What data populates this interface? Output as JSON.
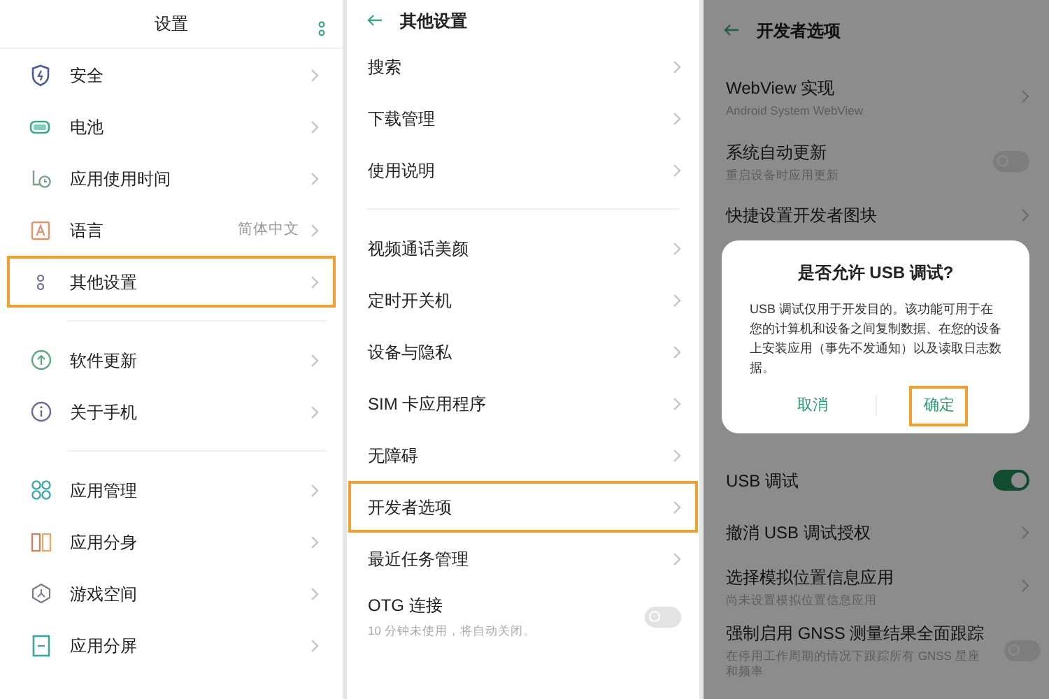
{
  "settings": {
    "title": "设置",
    "groups": [
      {
        "items": [
          {
            "label": "安全",
            "highlighted": false
          },
          {
            "label": "电池",
            "highlighted": false
          },
          {
            "label": "应用使用时间",
            "highlighted": false
          },
          {
            "label": "语言",
            "value": "简体中文",
            "highlighted": false
          },
          {
            "label": "其他设置",
            "highlighted": true
          }
        ]
      },
      {
        "items": [
          {
            "label": "软件更新",
            "highlighted": false
          },
          {
            "label": "关于手机",
            "highlighted": false
          }
        ]
      },
      {
        "items": [
          {
            "label": "应用管理",
            "highlighted": false
          },
          {
            "label": "应用分身",
            "highlighted": false
          },
          {
            "label": "游戏空间",
            "highlighted": false
          },
          {
            "label": "应用分屏",
            "highlighted": false
          }
        ]
      }
    ]
  },
  "other_settings": {
    "title": "其他设置",
    "groups": [
      {
        "items": [
          {
            "kind": "link",
            "label": "搜索",
            "highlighted": false
          },
          {
            "kind": "link",
            "label": "下载管理",
            "highlighted": false
          },
          {
            "kind": "link",
            "label": "使用说明",
            "highlighted": false
          }
        ]
      },
      {
        "items": [
          {
            "kind": "link",
            "label": "视频通话美颜",
            "highlighted": false
          },
          {
            "kind": "link",
            "label": "定时开关机",
            "highlighted": false
          },
          {
            "kind": "link",
            "label": "设备与隐私",
            "highlighted": false
          },
          {
            "kind": "link",
            "label": "SIM 卡应用程序",
            "highlighted": false
          },
          {
            "kind": "link",
            "label": "无障碍",
            "highlighted": false
          },
          {
            "kind": "link",
            "label": "开发者选项",
            "highlighted": true
          },
          {
            "kind": "link",
            "label": "最近任务管理",
            "highlighted": false
          },
          {
            "kind": "toggle",
            "label": "OTG 连接",
            "subtitle": "10 分钟未使用，将自动关闭。",
            "on": false,
            "highlighted": false
          }
        ]
      }
    ]
  },
  "developer_options": {
    "title": "开发者选项",
    "items_above": [
      {
        "kind": "link",
        "label": "WebView 实现",
        "subtitle": "Android System WebView"
      },
      {
        "kind": "toggle",
        "label": "系统自动更新",
        "subtitle": "重启设备时应用更新",
        "on": false
      },
      {
        "kind": "link",
        "label": "快捷设置开发者图块"
      }
    ],
    "items_below": [
      {
        "kind": "toggle",
        "label": "USB 调试",
        "on": true
      },
      {
        "kind": "link",
        "label": "撤消 USB 调试授权"
      },
      {
        "kind": "link",
        "label": "选择模拟位置信息应用",
        "subtitle": "尚未设置模拟位置信息应用"
      },
      {
        "kind": "toggle",
        "label": "强制启用 GNSS 测量结果全面跟踪",
        "subtitle": "在停用工作周期的情况下跟踪所有 GNSS 星座和频率",
        "on": false
      }
    ],
    "dialog": {
      "title": "是否允许 USB 调试?",
      "message": "USB 调试仅用于开发目的。该功能可用于在您的计算机和设备之间复制数据、在您的设备上安装应用（事先不发通知）以及读取日志数据。",
      "buttons": [
        {
          "label": "取消",
          "highlighted": false
        },
        {
          "label": "确定",
          "highlighted": true
        }
      ]
    }
  }
}
